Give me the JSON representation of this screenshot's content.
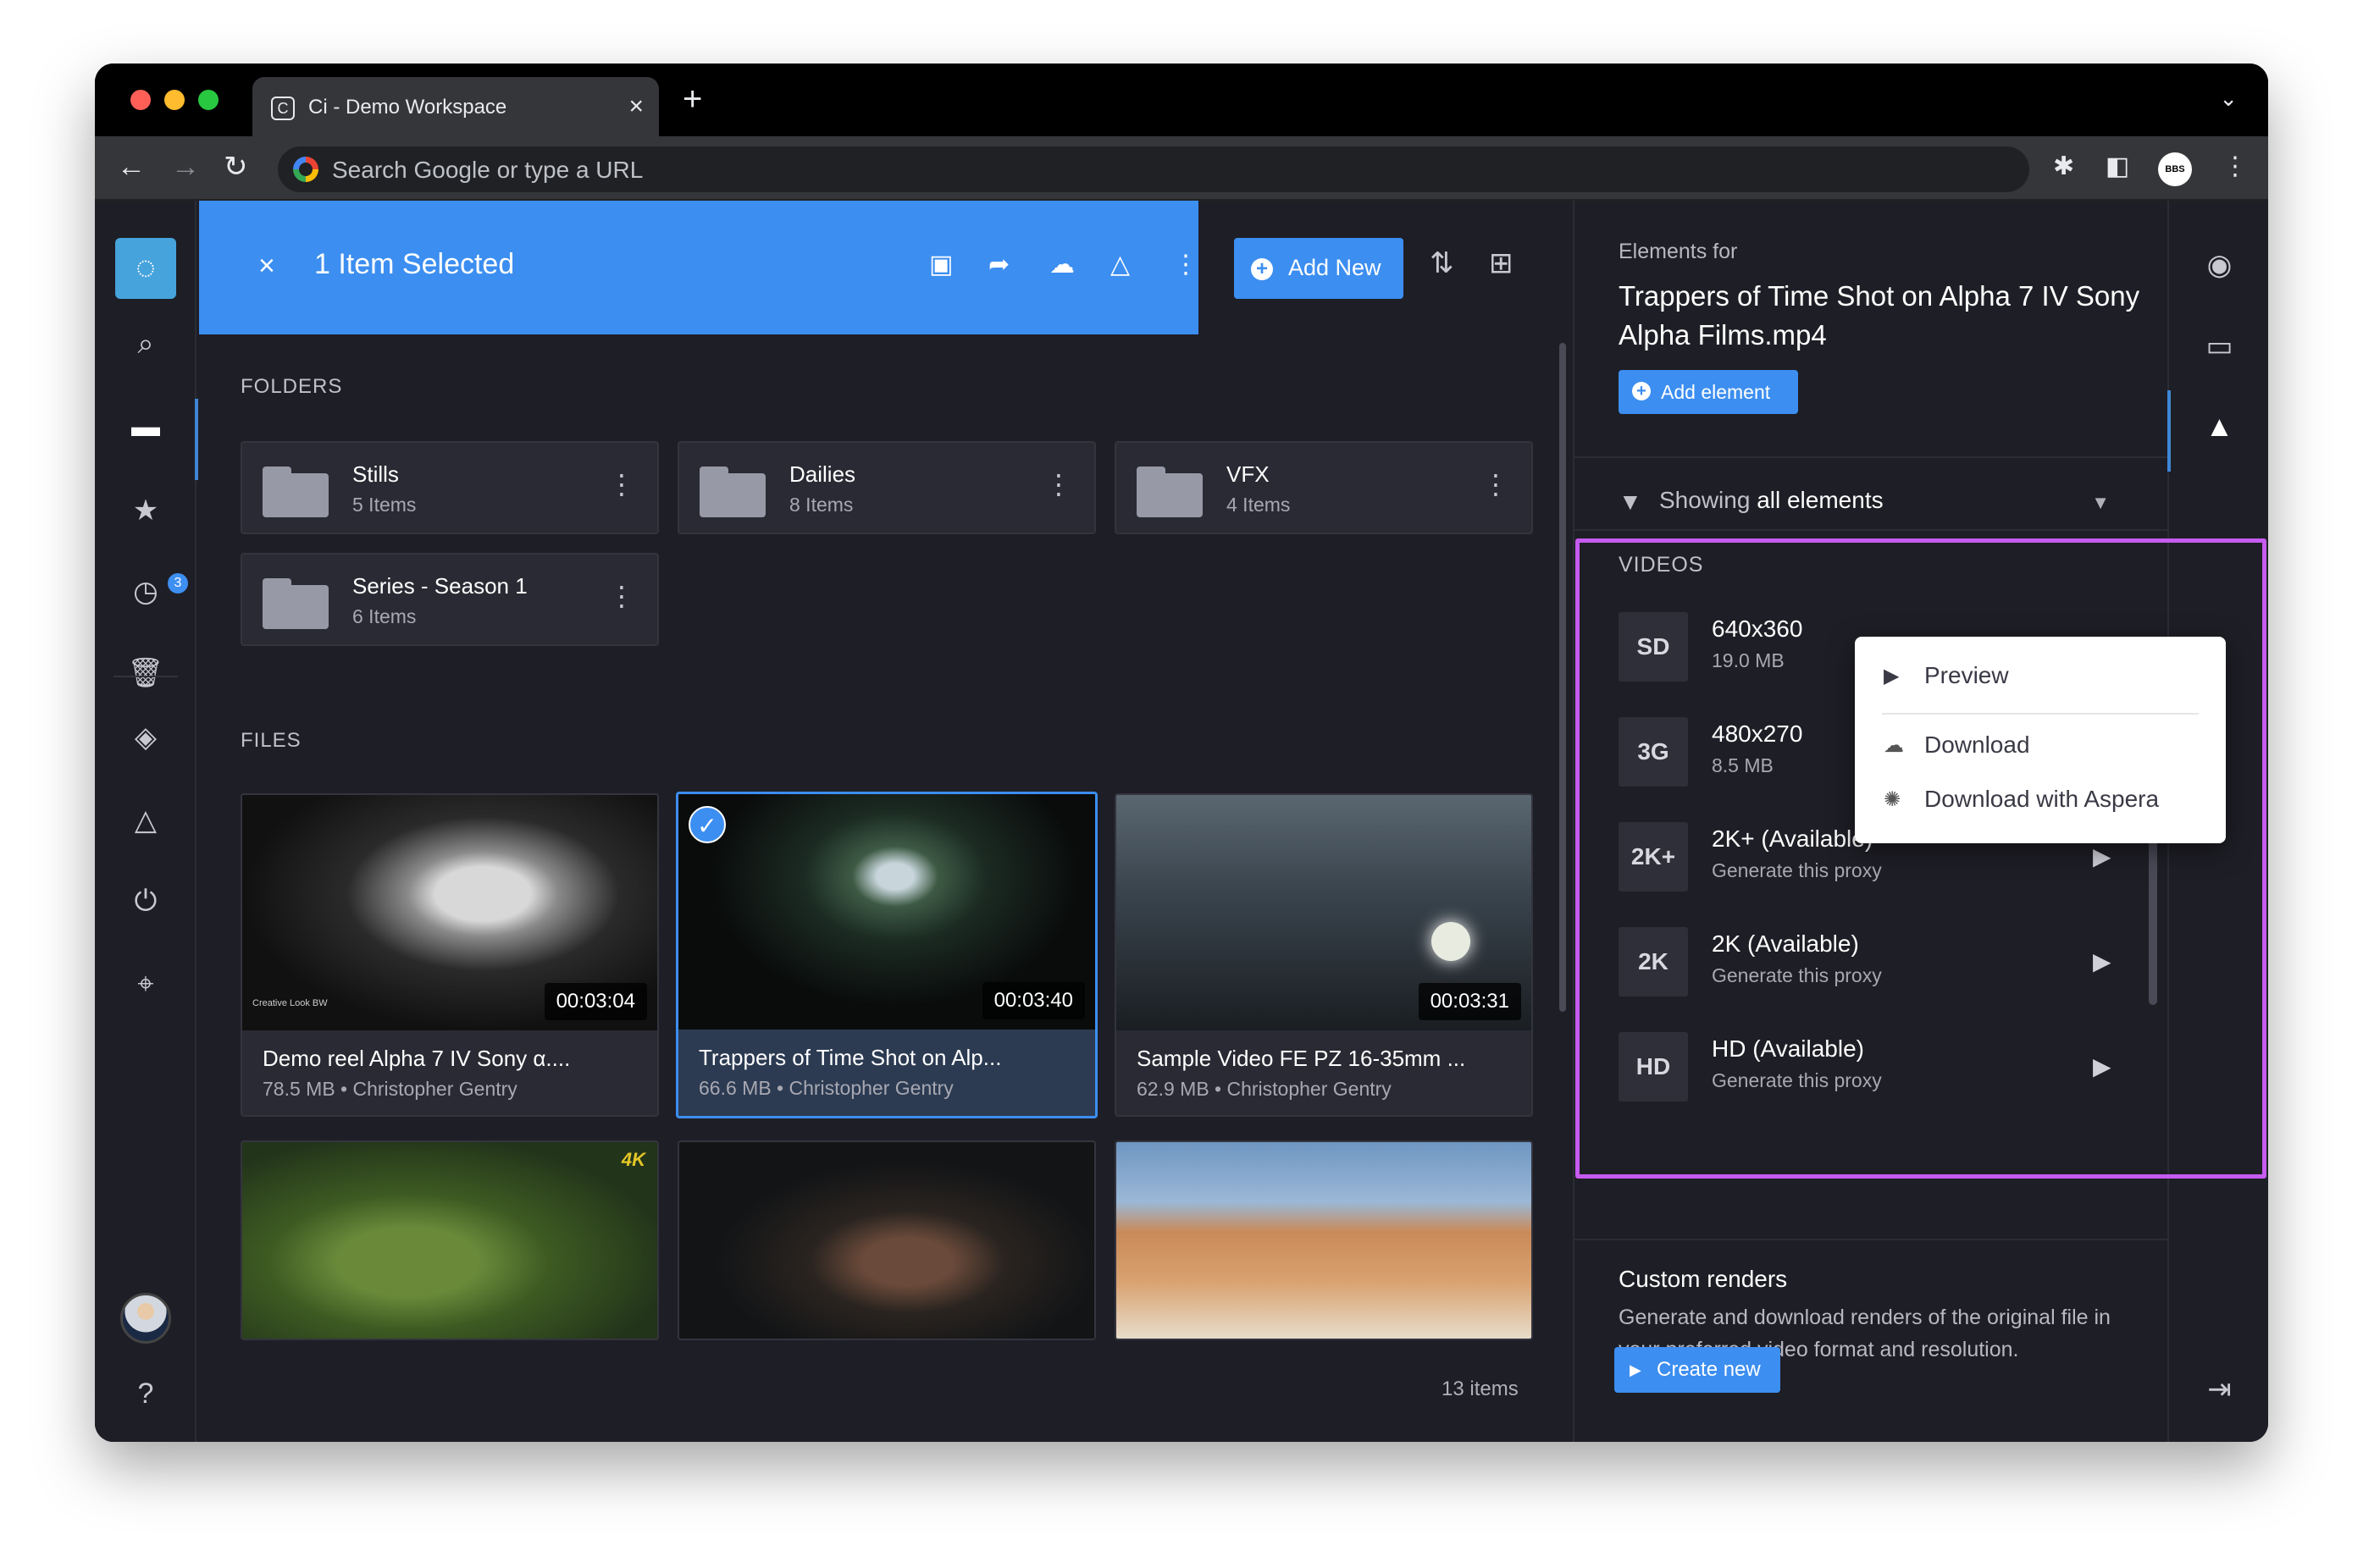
{
  "browser": {
    "tab_title": "Ci - Demo Workspace",
    "tab_close": "×",
    "new_tab": "+",
    "omnibox_placeholder": "Search Google or type a URL",
    "profile_label": "BBS"
  },
  "nav": {
    "logo": "Ci",
    "recent_badge": "3"
  },
  "selection_bar": {
    "close": "×",
    "title": "1 Item Selected"
  },
  "header": {
    "add_new_label": "Add New"
  },
  "folders": {
    "section_label": "FOLDERS",
    "items": [
      {
        "name": "Stills",
        "count": "5 Items"
      },
      {
        "name": "Dailies",
        "count": "8 Items"
      },
      {
        "name": "VFX",
        "count": "4 Items"
      },
      {
        "name": "Series - Season 1",
        "count": "6 Items"
      }
    ]
  },
  "files": {
    "section_label": "FILES",
    "items": [
      {
        "name": "Demo reel Alpha 7 IV Sony α....",
        "meta": "78.5 MB • Christopher Gentry",
        "duration": "00:03:04",
        "overlay": "Creative Look BW"
      },
      {
        "name": "Trappers of Time Shot on Alp...",
        "meta": "66.6 MB • Christopher Gentry",
        "duration": "00:03:40"
      },
      {
        "name": "Sample Video FE PZ 16-35mm ...",
        "meta": "62.9 MB • Christopher Gentry",
        "duration": "00:03:31"
      },
      {
        "name": "",
        "meta": "",
        "duration": "",
        "overlay": "4K"
      }
    ],
    "count_label": "13 items"
  },
  "panel": {
    "caption": "Elements for",
    "title": "Trappers of Time Shot on Alpha 7 IV Sony Alpha Films.mp4",
    "add_element_label": "Add element",
    "filter_prefix": "Showing",
    "filter_value": "all elements",
    "videos_label": "VIDEOS",
    "videos": [
      {
        "badge": "SD",
        "name": "640x360",
        "sub": "19.0 MB"
      },
      {
        "badge": "3G",
        "name": "480x270",
        "sub": "8.5 MB"
      },
      {
        "badge": "2K+",
        "name": "2K+ (Available)",
        "sub": "Generate this proxy"
      },
      {
        "badge": "2K",
        "name": "2K (Available)",
        "sub": "Generate this proxy"
      },
      {
        "badge": "HD",
        "name": "HD (Available)",
        "sub": "Generate this proxy"
      }
    ],
    "context_menu": [
      {
        "label": "Preview"
      },
      {
        "label": "Download"
      },
      {
        "label": "Download with Aspera"
      }
    ],
    "custom_renders_title": "Custom renders",
    "custom_renders_text": "Generate and download renders of the original file in your preferred video format and resolution.",
    "create_new_label": "Create new"
  },
  "colors": {
    "accent": "#3c8ef0",
    "highlight": "#c65bf0",
    "app_bg": "#1e1e26"
  }
}
